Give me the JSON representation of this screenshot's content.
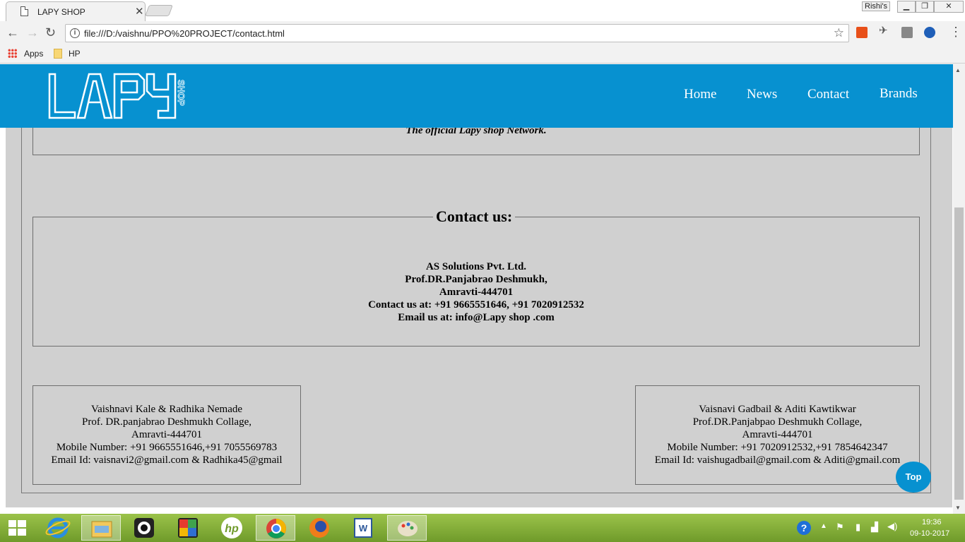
{
  "browser": {
    "tab_title": "LAPY SHOP",
    "tab_close": "✕",
    "profile_name": "Rishi's",
    "url": "file:///D:/vaishnu/PPO%20PROJECT/contact.html",
    "bookmarks": [
      {
        "label": "Apps",
        "icon": "apps-grid-icon"
      },
      {
        "label": "HP",
        "icon": "folder-icon"
      }
    ]
  },
  "site": {
    "logo_text": "LAPY",
    "logo_sub": "SHOP",
    "nav": [
      "Home",
      "News",
      "Contact",
      "Brands"
    ],
    "tagline": "The official Lapy shop Network.",
    "contact_heading": "Contact us:",
    "contact_lines": [
      "AS Solutions Pvt. Ltd.",
      "Prof.DR.Panjabrao Deshmukh,",
      "Amravti-444701",
      "Contact us at: +91 9665551646, +91 7020912532",
      "Email us at: info@Lapy shop .com"
    ],
    "left_card": [
      "Vaishnavi Kale & Radhika Nemade",
      "Prof. DR.panjabrao Deshmukh Collage,",
      "Amravti-444701",
      "Mobile Number: +91 9665551646,+91 7055569783",
      "Email Id: vaisnavi2@gmail.com & Radhika45@gmail"
    ],
    "right_card": [
      "Vaisnavi Gadbail & Aditi Kawtikwar",
      "Prof.DR.Panjabpao Deshmukh Collage,",
      "Amravti-444701",
      "Mobile Number: +91 7020912532,+91 7854642347",
      "Email Id: vaishugadbail@gmail.com & Aditi@gmail.com"
    ],
    "top_button": "Top",
    "brand_color": "#0791d0"
  },
  "taskbar": {
    "apps": [
      "start-icon",
      "internet-explorer-icon",
      "file-explorer-icon",
      "camera-icon",
      "puzzle-icon",
      "hp-icon",
      "chrome-icon",
      "firefox-icon",
      "word-icon",
      "paint-icon"
    ],
    "time": "19:36",
    "date": "09-10-2017"
  }
}
